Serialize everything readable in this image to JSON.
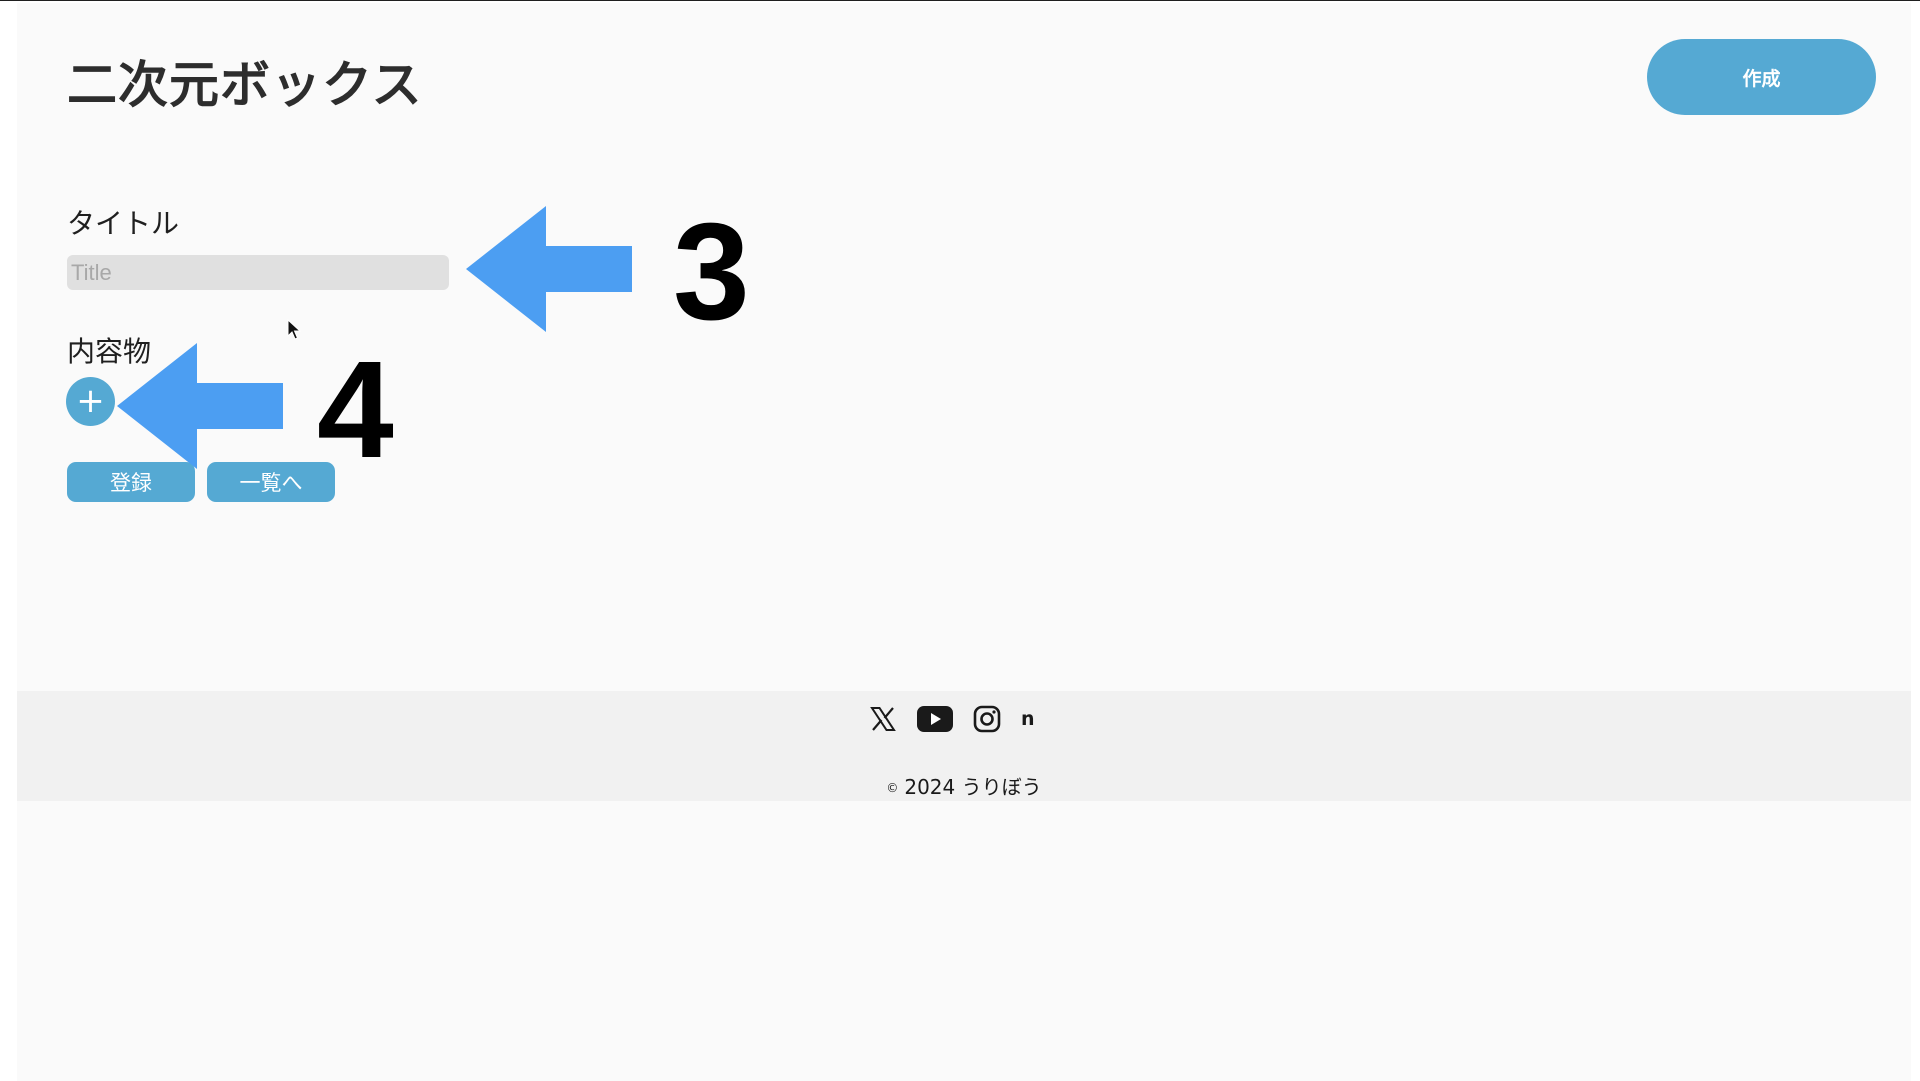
{
  "header": {
    "site_title": "二次元ボックス",
    "create_label": "作成"
  },
  "form": {
    "title_label": "タイトル",
    "title_value": "",
    "title_placeholder": "Title",
    "contents_label": "内容物",
    "add_item_label": "+",
    "register_label": "登録",
    "list_label": "一覧へ"
  },
  "annotations": {
    "arrow_3_number": "3",
    "arrow_4_number": "4",
    "arrow_color": "#4c9ef2"
  },
  "footer": {
    "social_icons": [
      "x-icon",
      "youtube-icon",
      "instagram-icon",
      "note-icon"
    ],
    "note_glyph": "n",
    "copyright_symbol": "©",
    "copyright_text": "2024 うりぼう"
  },
  "colors": {
    "accent": "#55a9d3",
    "page_background": "#fafafa",
    "footer_background": "#f1f1f1",
    "input_background": "#e0e0e0"
  }
}
